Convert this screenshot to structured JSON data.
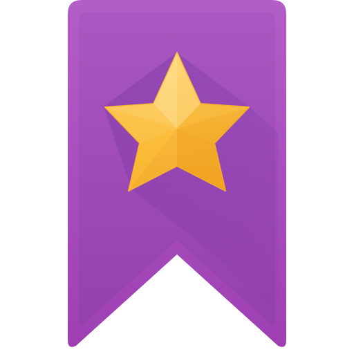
{
  "icon": {
    "name": "bookmark-star-icon",
    "ribbon_colors": {
      "outer_top": "#b35ec7",
      "outer_bottom": "#9d3fb3",
      "inner_top": "#a957c2",
      "inner_bottom": "#9440ad",
      "shadow": "#7e3aa6"
    },
    "star_colors": {
      "light": "#ffd36b",
      "mid": "#ffc23d",
      "dark": "#f2a51f",
      "shade": "#f6b12c"
    }
  }
}
